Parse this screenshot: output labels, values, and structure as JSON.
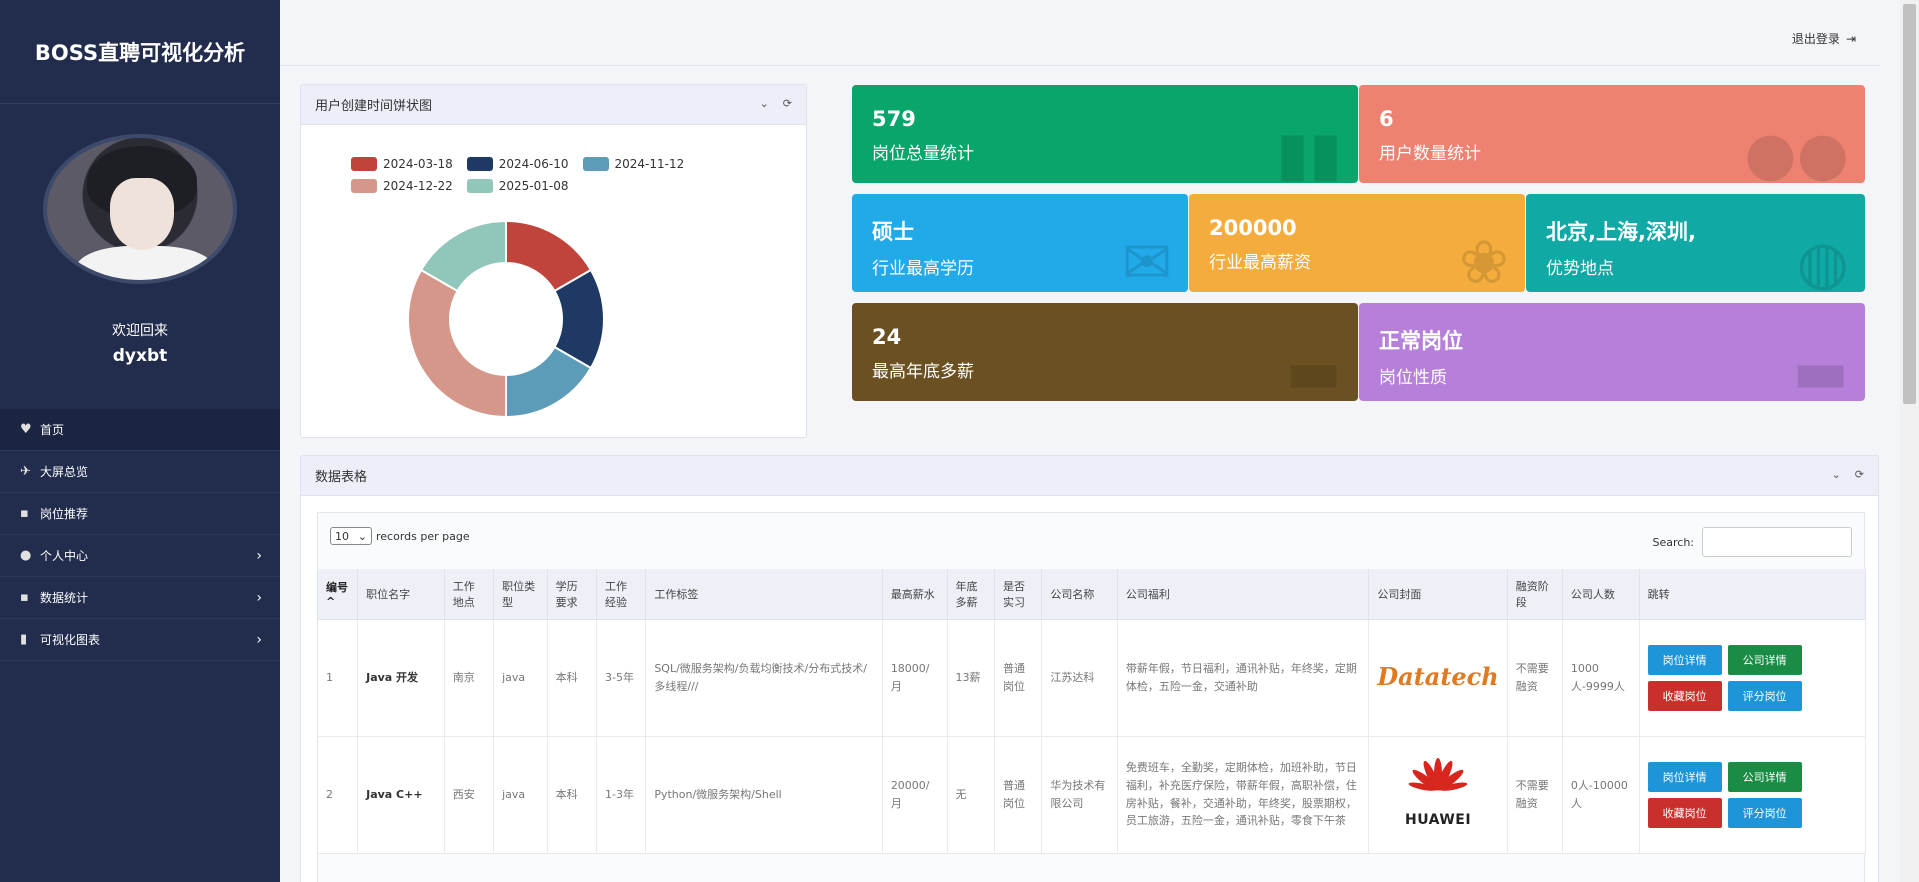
{
  "sidebar": {
    "brand": "BOSS直聘可视化分析",
    "welcome": "欢迎回来",
    "username": "dyxbt",
    "items": [
      {
        "label": "首页",
        "icon": "heart-icon"
      },
      {
        "label": "大屏总览",
        "icon": "plane-icon"
      },
      {
        "label": "岗位推荐",
        "icon": "grid-icon"
      },
      {
        "label": "个人中心",
        "icon": "user-icon"
      },
      {
        "label": "数据统计",
        "icon": "grid-icon"
      },
      {
        "label": "可视化图表",
        "icon": "bar-chart-icon"
      }
    ]
  },
  "topbar": {
    "logout": "退出登录"
  },
  "pie_panel": {
    "title": "用户创建时间饼状图"
  },
  "chart_data": {
    "type": "pie",
    "categories": [
      "2024-03-18",
      "2024-06-10",
      "2024-11-12",
      "2024-12-22",
      "2025-01-08"
    ],
    "values": [
      1,
      1,
      1,
      2,
      1
    ],
    "colors": [
      "#c1443c",
      "#1e3a64",
      "#5d9cb8",
      "#d5978a",
      "#91c7bb"
    ],
    "legend_position": "top"
  },
  "cards": [
    {
      "value": "579",
      "label": "岗位总量统计",
      "color": "#09a56a",
      "icon": "bar-chart-icon"
    },
    {
      "value": "6",
      "label": "用户数量统计",
      "color": "#ed8271",
      "icon": "users-icon"
    },
    {
      "value": "硕士",
      "label": "行业最高学历",
      "color": "#21a9e8",
      "icon": "envelope-icon"
    },
    {
      "value": "200000",
      "label": "行业最高薪资",
      "color": "#f4ad3d",
      "icon": "gift-icon"
    },
    {
      "value": "北京,上海,深圳,",
      "label": "优势地点",
      "color": "#10a9a6",
      "icon": "globe-icon"
    },
    {
      "value": "24",
      "label": "最高年底多薪",
      "color": "#6b5122",
      "icon": "briefcase-icon"
    },
    {
      "value": "正常岗位",
      "label": "岗位性质",
      "color": "#b57fda",
      "icon": "briefcase-icon"
    }
  ],
  "table_panel": {
    "title": "数据表格",
    "length_value": "10",
    "length_label": "records per page",
    "search_label": "Search:",
    "columns": [
      "编号",
      "职位名字",
      "工作地点",
      "职位类型",
      "学历要求",
      "工作经验",
      "工作标签",
      "最高薪水",
      "年底多薪",
      "是否实习",
      "公司名称",
      "公司福利",
      "公司封面",
      "融资阶段",
      "公司人数",
      "跳转"
    ],
    "rows": [
      {
        "id": "1",
        "name": "Java 开发",
        "city": "南京",
        "type": "java",
        "edu": "本科",
        "exp": "3-5年",
        "tags": "SQL/微服务架构/负载均衡技术/分布式技术/多线程///",
        "salary": "18000/月",
        "bonus": "13薪",
        "intern": "普通岗位",
        "company": "江苏达科",
        "welfare": "带薪年假，节日福利，通讯补贴，年终奖，定期体检，五险一金，交通补助",
        "logo_text": "Datatech",
        "funding": "不需要融资",
        "size": "1000人-9999人"
      },
      {
        "id": "2",
        "name": "Java C++",
        "city": "西安",
        "type": "java",
        "edu": "本科",
        "exp": "1-3年",
        "tags": "Python/微服务架构/Shell",
        "salary": "20000/月",
        "bonus": "无",
        "intern": "普通岗位",
        "company": "华为技术有限公司",
        "welfare": "免费班车，全勤奖，定期体检，加班补助，节日福利，补充医疗保险，带薪年假，高职补偿，住房补贴，餐补，交通补助，年终奖，股票期权，员工旅游，五险一金，通讯补贴，零食下午茶",
        "logo_text": "HUAWEI",
        "funding": "不需要融资",
        "size": "0人-10000人"
      }
    ],
    "buttons": [
      "岗位详情",
      "公司详情",
      "收藏岗位",
      "评分岗位"
    ]
  }
}
